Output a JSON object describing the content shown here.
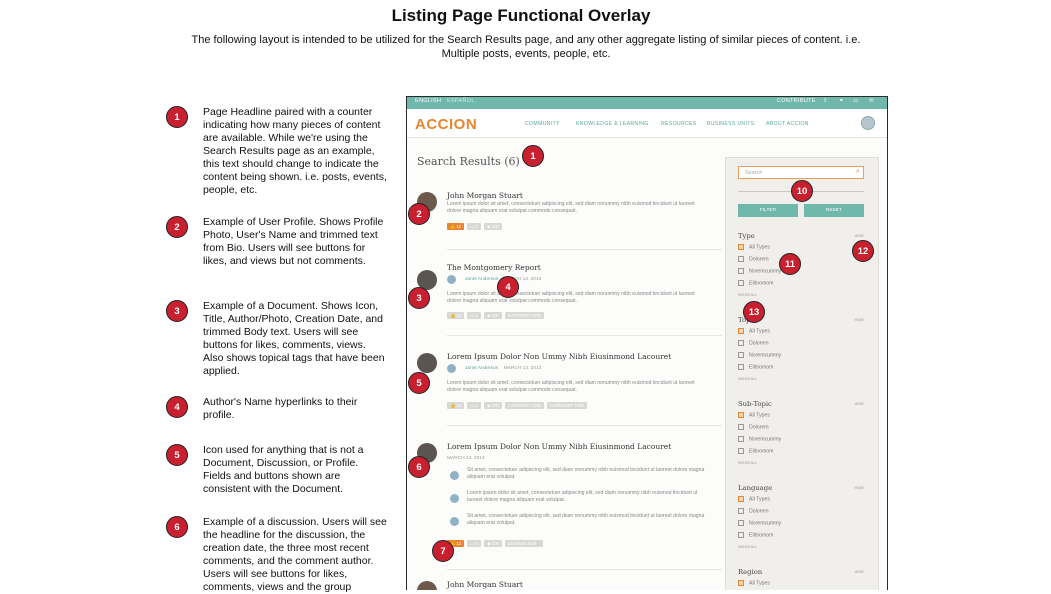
{
  "title": "Listing Page Functional Overlay",
  "intro": "The following layout is intended to be utilized for the Search Results page, and any other aggregate listing of similar pieces of content. i.e. Multiple posts, events, people, etc.",
  "notes": [
    {
      "num": "1",
      "text": "Page Headline paired with a counter indicating how many pieces of content are available. While we're using the Search Results page as an example, this text should change to indicate the content being shown. i.e. posts, events, people, etc."
    },
    {
      "num": "2",
      "text": "Example of User Profile. Shows Profile Photo, User's Name and trimmed text from Bio. Users will see buttons for likes, and views but not comments."
    },
    {
      "num": "3",
      "text": "Example of a Document. Shows Icon, Title, Author/Photo, Creation Date, and trimmed Body text. Users will see buttons for likes, comments, views. Also shows topical tags that have been applied."
    },
    {
      "num": "4",
      "text": "Author's Name hyperlinks to their profile."
    },
    {
      "num": "5",
      "text": "Icon used for anything that is not a Document, Discussion, or Profile. Fields and buttons shown are consistent with the Document."
    },
    {
      "num": "6",
      "text": "Example of a discussion. Users will see the headline for the discussion, the creation date, the three most recent comments, and the comment author. Users will see buttons for likes, comments, views and the group"
    }
  ],
  "mockup": {
    "topbar": {
      "left1": "ENGLISH",
      "left2": "ESPAÑOL",
      "right": "CONTRIBUTE"
    },
    "logo": "ACCION",
    "nav": [
      "COMMUNITY",
      "KNOWLEDGE & LEARNING",
      "RESOURCES",
      "BUSINESS UNITS",
      "ABOUT ACCION"
    ],
    "notification_count": "3",
    "results_heading": "Search Results (6)",
    "results": [
      {
        "title": "John Morgan Stuart",
        "body": "Lorem ipsum dolor sit amet, consectetuer adipiscing elit, sed diam nonummy nibh euismod tincidunt ut laoreet dolore magna aliquam erat volutpat commodo consequat.",
        "likes": "12",
        "comments": "0",
        "views": "100"
      },
      {
        "title": "The Montgomery Report",
        "author": "Janet Anderson",
        "date": "MARCH 13, 2013",
        "body": "Lorem ipsum dolor sit amet, consectetuer adipiscing elit, sed diam nonummy nibh euismod tincidunt ut laoreet dolore magna aliquam erat volutpat commodo consequat.",
        "likes": "12",
        "comments": "4",
        "views": "100",
        "tag1": "CATEGORY ONE"
      },
      {
        "title": "Lorem Ipsum Dolor Non Ummy Nibh Eiusinmond Lacouret",
        "author": "Janet Anderson",
        "date": "MARCH 13, 2013",
        "body": "Lorem ipsum dolor sit amet, consectetuer adipiscing elit, sed diam nonummy nibh euismod tincidunt ut laoreet dolore magna aliquam erat volutpat commodo consequat.",
        "likes": "12",
        "comments": "4",
        "views": "100",
        "tag1": "CATEGORY ONE",
        "tag2": "CATEGORY TWO"
      },
      {
        "title": "Lorem Ipsum Dolor Non Ummy Nibh Eiusinmond Lacouret",
        "date": "MARCH 13, 2013",
        "c1": "Sit amet, consectetuer adipiscing elit, sed diam nonummy nibh euismod tincidunt ut laoreet dolore magna aliquam erat volutpat.",
        "c2": "Lorem ipsum dolor sit amet, consectetuer adipiscing elit, sed diam nonummy nibh euismod tincidunt ut laoreet dolore magna aliquam erat volutpat.",
        "c3": "Sit amet, consectetuer adipiscing elit, sed diam nonummy nibh euismod tincidunt ut laoreet dolore magna aliquam erat volutpat.",
        "likes": "12",
        "comments": "4",
        "views": "100",
        "group": "EG Board Staff"
      },
      {
        "title": "John Morgan Stuart"
      }
    ],
    "sidebar": {
      "search_placeholder": "Search",
      "filter_label": "FILTER",
      "reset_label": "RESET",
      "hide_label": "HIDE",
      "show_all": "SHOW ALL",
      "facets": [
        {
          "heading": "Type",
          "options": [
            "All Types",
            "Dolorem",
            "Noremcummy",
            "Elitnomom"
          ]
        },
        {
          "heading": "Topic",
          "options": [
            "All Types",
            "Dolorem",
            "Noremcummy",
            "Elitnomom"
          ]
        },
        {
          "heading": "Sub-Topic",
          "options": [
            "All Types",
            "Dolorem",
            "Noremcummy",
            "Elitnomom"
          ]
        },
        {
          "heading": "Language",
          "options": [
            "All Types",
            "Dolorem",
            "Noremcummy",
            "Elitnomom"
          ]
        },
        {
          "heading": "Region",
          "options": [
            "All Types"
          ]
        }
      ]
    }
  },
  "callouts": [
    "1",
    "2",
    "3",
    "4",
    "5",
    "6",
    "7",
    "10",
    "11",
    "12",
    "13"
  ],
  "colors": {
    "badge": "#c8202f",
    "teal": "#6fb8ab",
    "orange": "#e8852f"
  }
}
